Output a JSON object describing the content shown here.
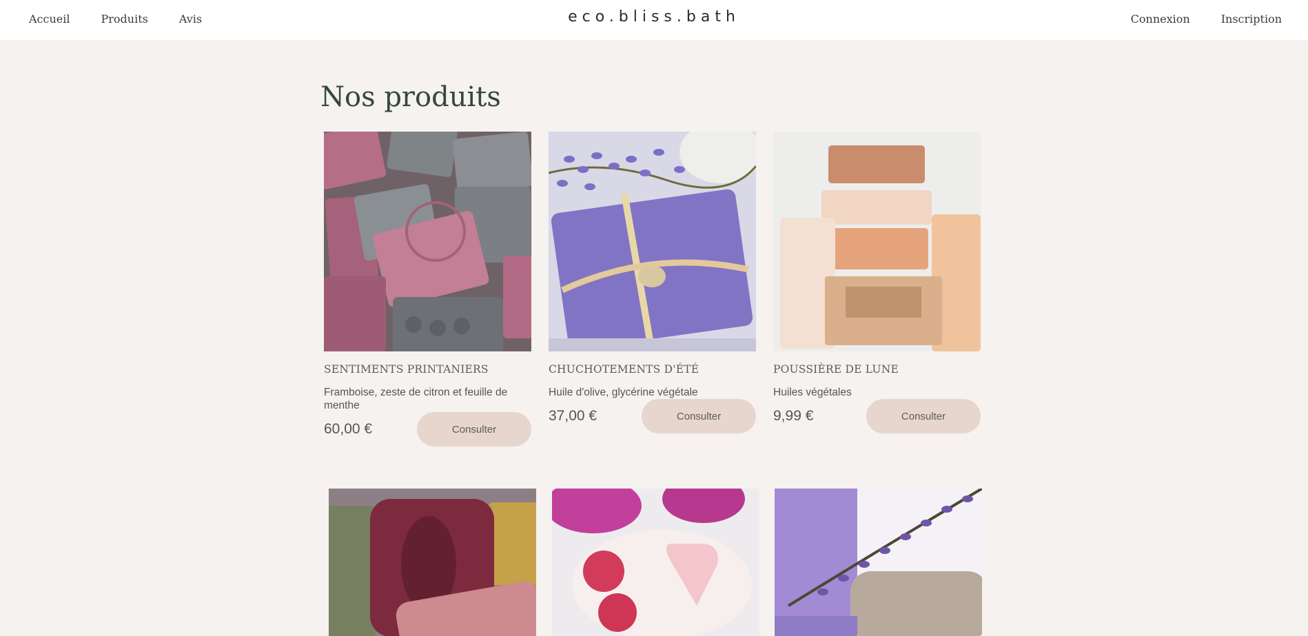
{
  "header": {
    "nav_left": [
      "Accueil",
      "Produits",
      "Avis"
    ],
    "logo": "eco.bliss.bath",
    "nav_right": [
      "Connexion",
      "Inscription"
    ]
  },
  "main": {
    "title": "Nos produits",
    "products": [
      {
        "name": "Sentiments printaniers",
        "description": "Framboise, zeste de citron et feuille de menthe",
        "price": "60,00 €",
        "button": "Consulter"
      },
      {
        "name": "Chuchotements d'été",
        "description": "Huile d'olive, glycérine végétale",
        "price": "37,00 €",
        "button": "Consulter"
      },
      {
        "name": "Poussière de lune",
        "description": "Huiles végétales",
        "price": "9,99 €",
        "button": "Consulter"
      }
    ]
  },
  "colors": {
    "page_background": "#f6f2ef",
    "header_background": "#ffffff",
    "title_color": "#35473c",
    "button_background": "#e7d6cd"
  }
}
